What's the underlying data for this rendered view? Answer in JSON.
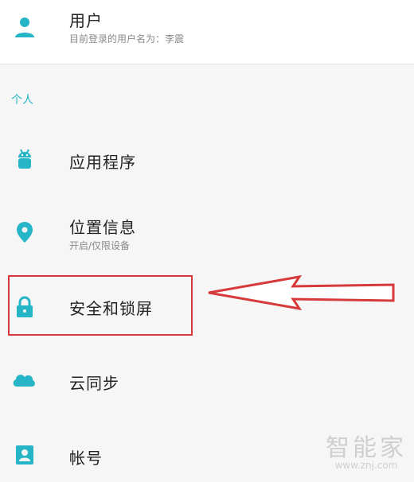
{
  "user": {
    "title": "用户",
    "subtitle": "目前登录的用户名为：李震",
    "icon": "person-icon"
  },
  "section": {
    "label": "个人"
  },
  "items": [
    {
      "title": "应用程序",
      "subtitle": "",
      "icon": "android-icon"
    },
    {
      "title": "位置信息",
      "subtitle": "开启/仅限设备",
      "icon": "location-pin-icon"
    },
    {
      "title": "安全和锁屏",
      "subtitle": "",
      "icon": "lock-icon"
    },
    {
      "title": "云同步",
      "subtitle": "",
      "icon": "cloud-icon"
    },
    {
      "title": "帐号",
      "subtitle": "",
      "icon": "account-box-icon"
    }
  ],
  "annotation": {
    "highlight_color": "#d63a3a",
    "points_to": "安全和锁屏"
  },
  "watermark": {
    "title": "智能家",
    "url": "www.znj.com"
  },
  "colors": {
    "accent": "#26b5c6",
    "annotation": "#d63a3a"
  }
}
